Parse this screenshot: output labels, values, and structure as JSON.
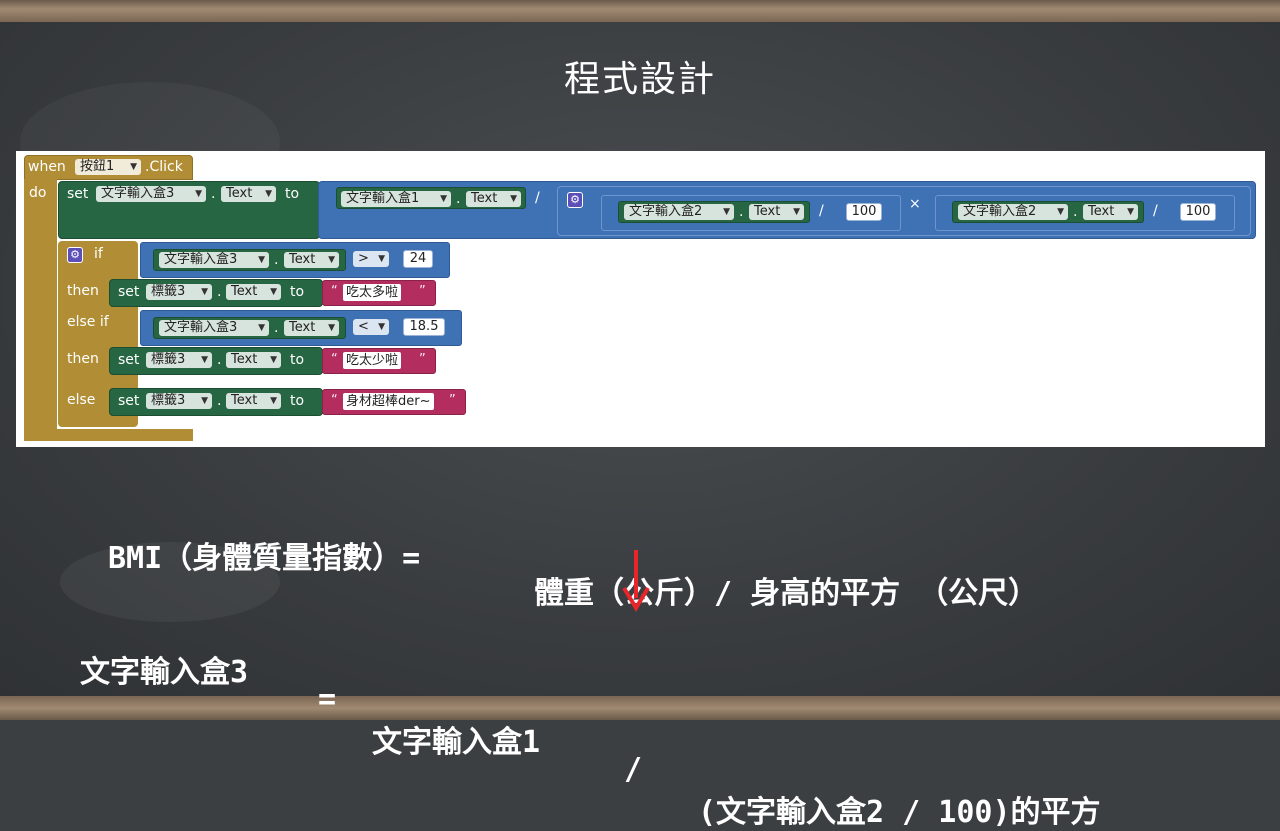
{
  "slide_title": "程式設計",
  "blocks": {
    "when_kw": "when",
    "event_component": "按鈕1",
    "event_name": ".Click",
    "do_kw": "do",
    "set_kw": "set",
    "to_kw": "to",
    "dot": ".",
    "prop_text": "Text",
    "tb1": "文字輸入盒1",
    "tb2": "文字輸入盒2",
    "tb3": "文字輸入盒3",
    "label3": "標籤3",
    "div_op": "/",
    "mul_op": "×",
    "num_100": "100",
    "if_kw": "if",
    "then_kw": "then",
    "elseif_kw": "else if",
    "else_kw": "else",
    "cmp_gt": ">",
    "cmp_lt": "<",
    "num_24": "24",
    "num_18_5": "18.5",
    "str_too_much": "吃太多啦",
    "str_too_little": "吃太少啦",
    "str_good": "身材超棒der~",
    "quote_open": "“",
    "quote_close": "”"
  },
  "formula": {
    "bmi_label": "BMI（身體質量指數）=",
    "bmi_rhs": "體重（公斤）/ 身高的平方 （公尺）",
    "line2_lhs": "文字輸入盒3",
    "line2_eq": "=",
    "line2_tb1": "文字輸入盒1",
    "line2_div": "/",
    "line2_rest": "(文字輸入盒2 / 100)的平方"
  },
  "colors": {
    "event": "#b18e35",
    "setter": "#266643",
    "math": "#3f71b5",
    "text_block": "#b32d5e",
    "arrow": "#e8262a",
    "board": "#3b3f42"
  }
}
